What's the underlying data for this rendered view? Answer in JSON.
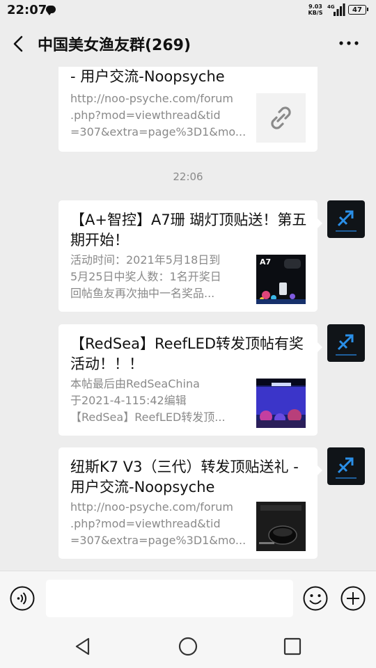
{
  "status_bar": {
    "time": "22:07",
    "net_speed_value": "9.03",
    "net_speed_unit": "KB/S",
    "network_type": "4G",
    "battery": "47"
  },
  "header": {
    "title": "中国美女渔友群(269)"
  },
  "messages": [
    {
      "title": "- 用户交流-Noopsyche",
      "desc_lines": [
        "http://noo-psyche.com/forum",
        ".php?mod=viewthread&tid",
        "=307&extra=page%3D1&mo..."
      ],
      "thumb": "link-icon"
    },
    {
      "timestamp": "22:06"
    },
    {
      "title": "【A+智控】A7珊 瑚灯顶贴送！第五期开始！",
      "desc_lines": [
        "活动时间：2021年5月18日到",
        "5月25日中奖人数：1名开奖日",
        "回帖鱼友再次抽中一名奖品..."
      ],
      "thumb_text": "A7"
    },
    {
      "title": "【RedSea】ReefLED转发顶帖有奖活动！！！",
      "desc_lines": [
        "本帖最后由RedSeaChina",
        "于2021-4-115:42编辑",
        "【RedSea】ReefLED转发顶..."
      ]
    },
    {
      "title": "纽斯K7 V3（三代）转发顶贴送礼 - 用户交流-Noopsyche",
      "desc_lines": [
        "http://noo-psyche.com/forum",
        ".php?mod=viewthread&tid",
        "=307&extra=page%3D1&mo..."
      ]
    }
  ],
  "colors": {
    "background": "#ededed",
    "card": "#ffffff",
    "secondary_text": "#8a8a8a"
  },
  "input_bar": {
    "voice_icon": "voice-icon",
    "emoji_icon": "emoji-icon",
    "plus_icon": "plus-icon"
  },
  "nav_bar": {
    "back_icon": "triangle-back-icon",
    "home_icon": "circle-home-icon",
    "recents_icon": "square-recents-icon"
  }
}
